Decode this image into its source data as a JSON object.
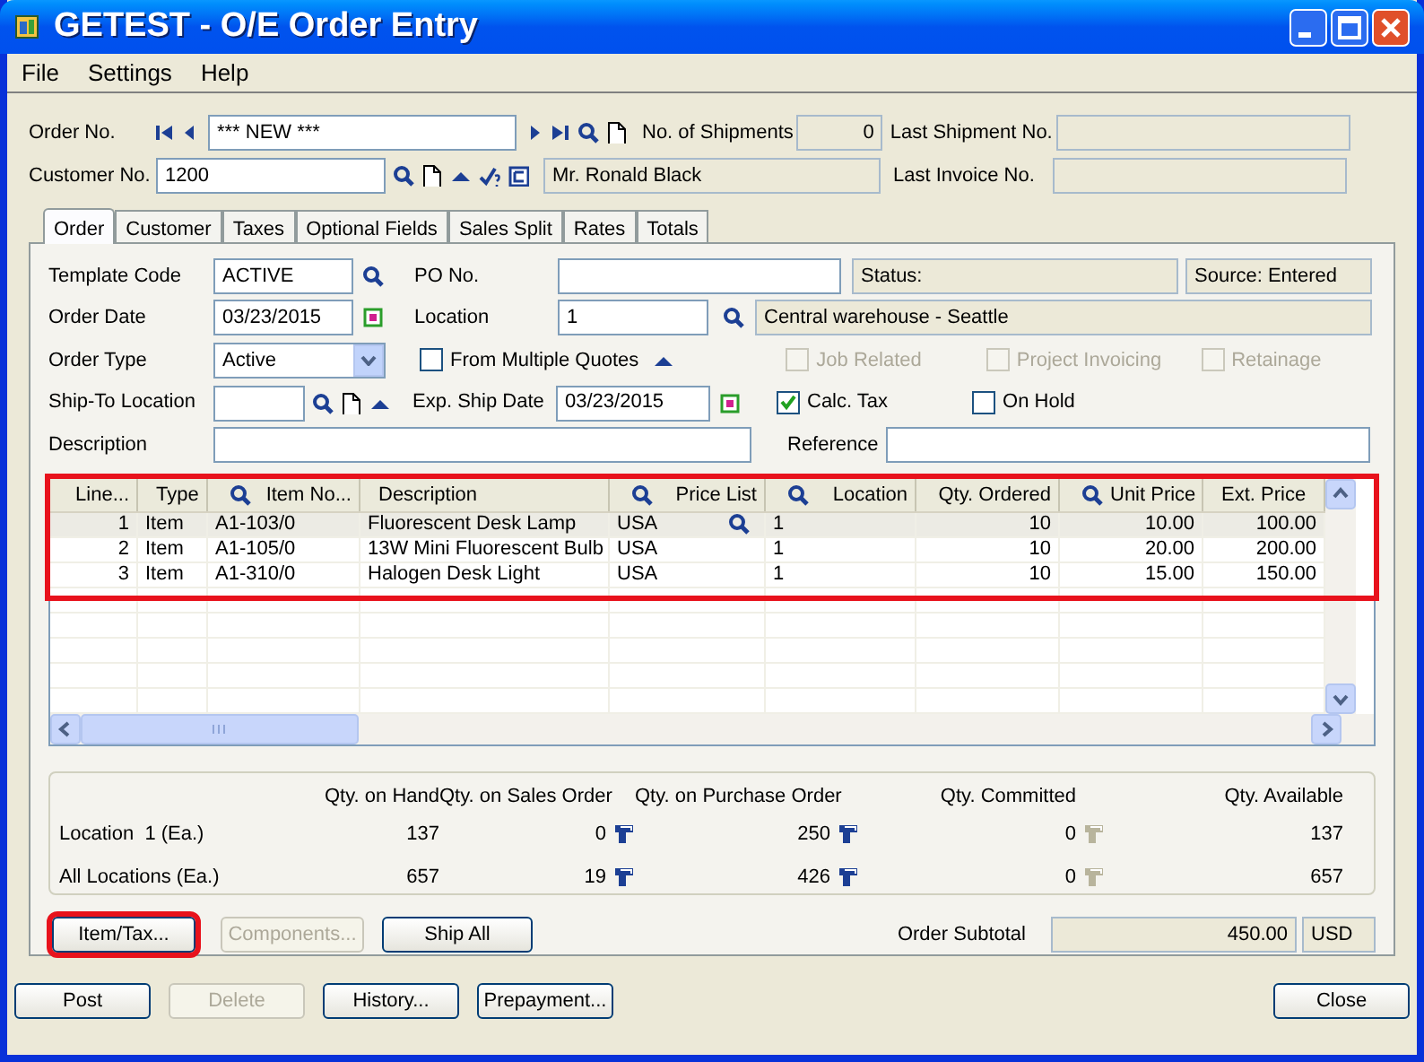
{
  "window": {
    "title": "GETEST - O/E Order Entry"
  },
  "menu": [
    {
      "label": "File"
    },
    {
      "label": "Settings"
    },
    {
      "label": "Help"
    }
  ],
  "header": {
    "order_no": {
      "label": "Order No.",
      "value": "*** NEW ***"
    },
    "shipments": {
      "label": "No. of Shipments",
      "value": "0"
    },
    "last_shipment": {
      "label": "Last Shipment No."
    },
    "customer_no": {
      "label": "Customer No.",
      "value": "1200"
    },
    "customer_name": "Mr. Ronald Black",
    "last_invoice": {
      "label": "Last Invoice No."
    }
  },
  "tabs": [
    {
      "label": "Order",
      "selected": true
    },
    {
      "label": "Customer",
      "selected": false
    },
    {
      "label": "Taxes",
      "selected": false
    },
    {
      "label": "Optional Fields",
      "selected": false
    },
    {
      "label": "Sales Split",
      "selected": false
    },
    {
      "label": "Rates",
      "selected": false
    },
    {
      "label": "Totals",
      "selected": false
    }
  ],
  "order": {
    "template_code": {
      "label": "Template Code",
      "value": "ACTIVE"
    },
    "po_no": {
      "label": "PO No."
    },
    "status": "Status:",
    "source": "Source: Entered",
    "order_date": {
      "label": "Order Date",
      "value": "03/23/2015"
    },
    "location": {
      "label": "Location",
      "value": "1",
      "description": "Central warehouse - Seattle"
    },
    "order_type": {
      "label": "Order Type",
      "value": "Active"
    },
    "ship_to": {
      "label": "Ship-To Location"
    },
    "exp_ship_date": {
      "label": "Exp. Ship Date",
      "value": "03/23/2015"
    },
    "checkboxes": [
      {
        "label": "From Multiple Quotes",
        "checked": false,
        "disabled": false
      },
      {
        "label": "Job Related",
        "checked": false,
        "disabled": true
      },
      {
        "label": "Project Invoicing",
        "checked": false,
        "disabled": true
      },
      {
        "label": "Retainage",
        "checked": false,
        "disabled": true
      },
      {
        "label": "Calc. Tax",
        "checked": true,
        "disabled": false
      },
      {
        "label": "On Hold",
        "checked": false,
        "disabled": false
      }
    ],
    "description": {
      "label": "Description"
    },
    "reference": {
      "label": "Reference"
    }
  },
  "grid": {
    "highlighted": true,
    "columns": [
      {
        "label": "Line...",
        "search": false
      },
      {
        "label": "Type",
        "search": false
      },
      {
        "label": "Item No...",
        "search": true
      },
      {
        "label": "Description",
        "search": false
      },
      {
        "label": "Price List",
        "search": true
      },
      {
        "label": "Location",
        "search": true
      },
      {
        "label": "Qty. Ordered",
        "search": false
      },
      {
        "label": "Unit Price",
        "search": true
      },
      {
        "label": "Ext. Price",
        "search": false
      }
    ],
    "rows": [
      {
        "selected": true,
        "cells": [
          "1",
          "Item",
          "A1-103/0",
          "Fluorescent Desk Lamp",
          "USA",
          "1",
          "10",
          "10.00",
          "100.00"
        ]
      },
      {
        "selected": false,
        "cells": [
          "2",
          "Item",
          "A1-105/0",
          "13W Mini Fluorescent Bulb",
          "USA",
          "1",
          "10",
          "20.00",
          "200.00"
        ]
      },
      {
        "selected": false,
        "cells": [
          "3",
          "Item",
          "A1-310/0",
          "Halogen Desk Light",
          "USA",
          "1",
          "10",
          "15.00",
          "150.00"
        ]
      }
    ]
  },
  "inventory": {
    "columns": [
      "Qty. on Hand",
      "Qty. on Sales Order",
      "Qty. on Purchase Order",
      "Qty. Committed",
      "Qty. Available"
    ],
    "rows": [
      {
        "label": "Location  1 (Ea.)",
        "values": [
          "137",
          "0",
          "250",
          "0",
          "137"
        ]
      },
      {
        "label": "All Locations (Ea.)",
        "values": [
          "657",
          "19",
          "426",
          "0",
          "657"
        ]
      }
    ],
    "drilldowns": [
      {
        "disabled": false
      },
      {
        "disabled": false
      },
      {
        "disabled": true
      }
    ]
  },
  "detail_buttons": [
    {
      "label": "Item/Tax...",
      "disabled": false,
      "highlighted": true
    },
    {
      "label": "Components...",
      "disabled": true,
      "highlighted": false
    },
    {
      "label": "Ship All",
      "disabled": false,
      "highlighted": false
    }
  ],
  "subtotal": {
    "label": "Order Subtotal",
    "value": "450.00",
    "currency": "USD"
  },
  "buttons": [
    {
      "label": "Post",
      "disabled": false
    },
    {
      "label": "Delete",
      "disabled": true
    },
    {
      "label": "History...",
      "disabled": false
    },
    {
      "label": "Prepayment...",
      "disabled": false
    }
  ],
  "close_button": {
    "label": "Close",
    "disabled": false
  }
}
